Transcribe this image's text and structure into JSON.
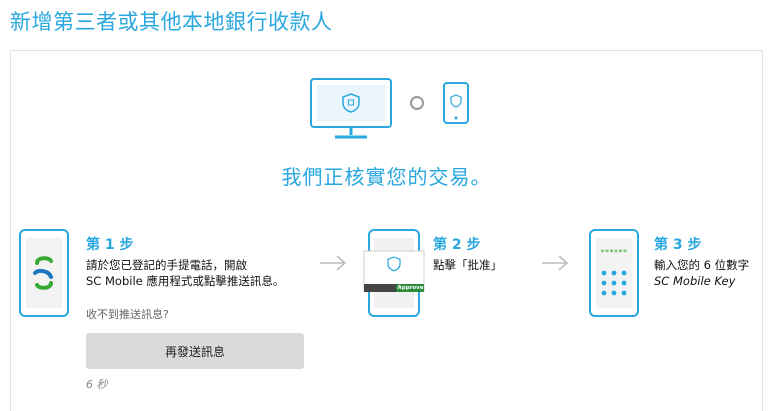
{
  "page": {
    "title": "新增第三者或其他本地銀行收款人"
  },
  "verify": {
    "status_text": "我們正核實您的交易。"
  },
  "steps": [
    {
      "title": "第 1 步",
      "line1": "請於您已登記的手提電話，開啟",
      "line2": "SC Mobile 應用程式或點擊推送訊息。"
    },
    {
      "title": "第 2 步",
      "line1": "點擊「批准」",
      "approve_label": "Approve"
    },
    {
      "title": "第 3 步",
      "line1": "輸入您的 6 位數字",
      "line2": "SC Mobile Key",
      "code_mask": "******"
    }
  ],
  "resend": {
    "question": "收不到推送訊息?",
    "button_label": "再發送訊息",
    "countdown": "6 秒"
  },
  "colors": {
    "accent": "#29a7df",
    "brand_green": "#39a935",
    "approve_green": "#2e8b3b"
  },
  "icons": [
    "monitor-shield-icon",
    "phone-shield-icon",
    "sc-logo-icon",
    "arrow-right-icon",
    "keypad-icon"
  ]
}
